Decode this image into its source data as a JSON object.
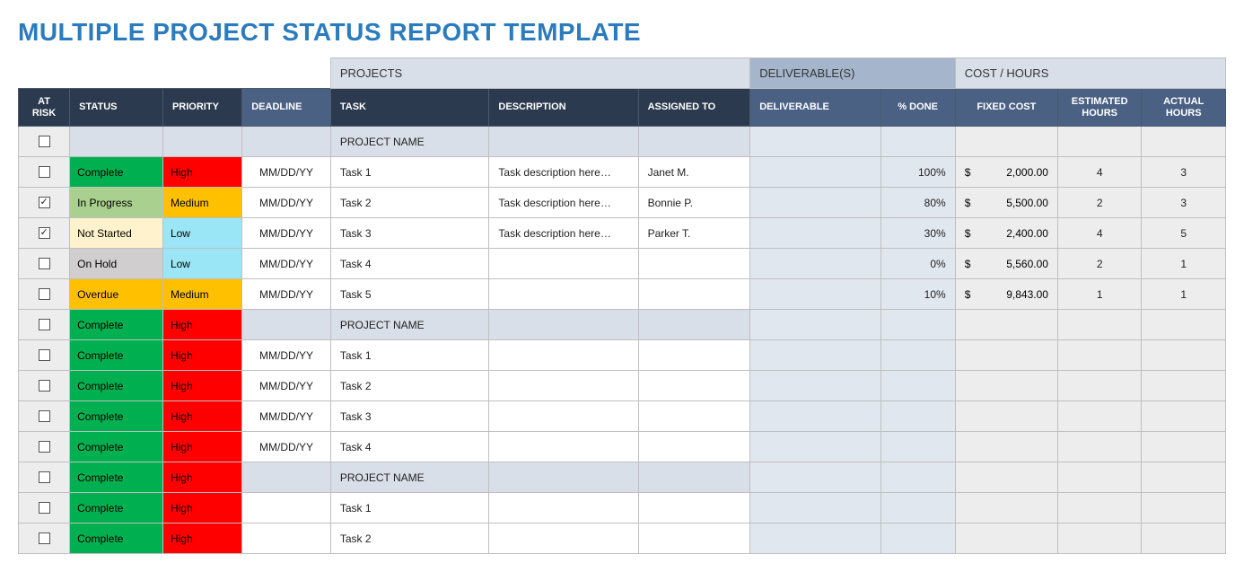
{
  "title": "MULTIPLE PROJECT STATUS REPORT TEMPLATE",
  "groups": {
    "projects": "PROJECTS",
    "deliverables": "DELIVERABLE(S)",
    "cost": "COST / HOURS"
  },
  "headers": {
    "at_risk": "AT RISK",
    "status": "STATUS",
    "priority": "PRIORITY",
    "deadline": "DEADLINE",
    "task": "TASK",
    "description": "DESCRIPTION",
    "assigned_to": "ASSIGNED TO",
    "deliverable": "DELIVERABLE",
    "pct_done": "% DONE",
    "fixed_cost": "FIXED COST",
    "est_hours": "ESTIMATED HOURS",
    "act_hours": "ACTUAL HOURS"
  },
  "currency": "$",
  "rows": [
    {
      "type": "project",
      "at_risk": false,
      "task": "PROJECT NAME"
    },
    {
      "type": "task",
      "at_risk": false,
      "status": "Complete",
      "priority": "High",
      "deadline": "MM/DD/YY",
      "task": "Task 1",
      "description": "Task description here…",
      "assigned_to": "Janet M.",
      "pct_done": "100%",
      "fixed_cost": "2,000.00",
      "est_hours": "4",
      "act_hours": "3"
    },
    {
      "type": "task",
      "at_risk": true,
      "status": "In Progress",
      "priority": "Medium",
      "deadline": "MM/DD/YY",
      "task": "Task 2",
      "description": "Task description here…",
      "assigned_to": "Bonnie P.",
      "pct_done": "80%",
      "fixed_cost": "5,500.00",
      "est_hours": "2",
      "act_hours": "3"
    },
    {
      "type": "task",
      "at_risk": true,
      "status": "Not Started",
      "priority": "Low",
      "deadline": "MM/DD/YY",
      "task": "Task 3",
      "description": "Task description here…",
      "assigned_to": "Parker T.",
      "pct_done": "30%",
      "fixed_cost": "2,400.00",
      "est_hours": "4",
      "act_hours": "5"
    },
    {
      "type": "task",
      "at_risk": false,
      "status": "On Hold",
      "priority": "Low",
      "deadline": "MM/DD/YY",
      "task": "Task 4",
      "description": "",
      "assigned_to": "",
      "pct_done": "0%",
      "fixed_cost": "5,560.00",
      "est_hours": "2",
      "act_hours": "1"
    },
    {
      "type": "task",
      "at_risk": false,
      "status": "Overdue",
      "priority": "Medium",
      "deadline": "MM/DD/YY",
      "task": "Task 5",
      "description": "",
      "assigned_to": "",
      "pct_done": "10%",
      "fixed_cost": "9,843.00",
      "est_hours": "1",
      "act_hours": "1"
    },
    {
      "type": "project",
      "at_risk": false,
      "status": "Complete",
      "priority": "High",
      "task": "PROJECT NAME"
    },
    {
      "type": "task",
      "at_risk": false,
      "status": "Complete",
      "priority": "High",
      "deadline": "MM/DD/YY",
      "task": "Task 1"
    },
    {
      "type": "task",
      "at_risk": false,
      "status": "Complete",
      "priority": "High",
      "deadline": "MM/DD/YY",
      "task": "Task 2"
    },
    {
      "type": "task",
      "at_risk": false,
      "status": "Complete",
      "priority": "High",
      "deadline": "MM/DD/YY",
      "task": "Task 3"
    },
    {
      "type": "task",
      "at_risk": false,
      "status": "Complete",
      "priority": "High",
      "deadline": "MM/DD/YY",
      "task": "Task 4"
    },
    {
      "type": "project",
      "at_risk": false,
      "status": "Complete",
      "priority": "High",
      "task": "PROJECT NAME"
    },
    {
      "type": "task",
      "at_risk": false,
      "status": "Complete",
      "priority": "High",
      "task": "Task 1"
    },
    {
      "type": "task",
      "at_risk": false,
      "status": "Complete",
      "priority": "High",
      "task": "Task 2"
    }
  ]
}
